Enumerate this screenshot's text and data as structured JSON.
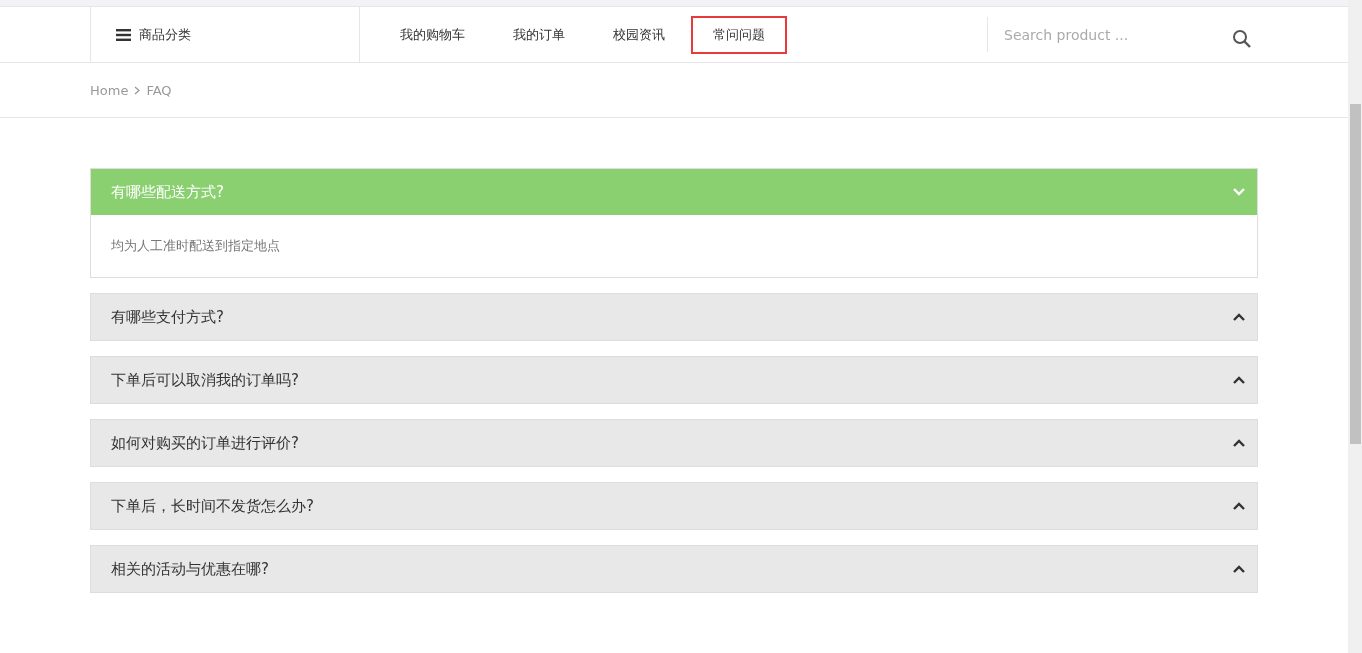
{
  "category_menu": {
    "label": "商品分类"
  },
  "nav": [
    {
      "label": "我的购物车",
      "selected": false
    },
    {
      "label": "我的订单",
      "selected": false
    },
    {
      "label": "校园资讯",
      "selected": false
    },
    {
      "label": "常问问题",
      "selected": true
    }
  ],
  "search": {
    "placeholder": "Search product ..."
  },
  "breadcrumb": [
    "Home",
    "FAQ"
  ],
  "faq": [
    {
      "question": "有哪些配送方式?",
      "answer": "均为人工准时配送到指定地点",
      "expanded": true
    },
    {
      "question": "有哪些支付方式?",
      "expanded": false
    },
    {
      "question": "下单后可以取消我的订单吗?",
      "expanded": false
    },
    {
      "question": "如何对购买的订单进行评价?",
      "expanded": false
    },
    {
      "question": "下单后，长时间不发货怎么办?",
      "expanded": false
    },
    {
      "question": "相关的活动与优惠在哪?",
      "expanded": false
    }
  ]
}
